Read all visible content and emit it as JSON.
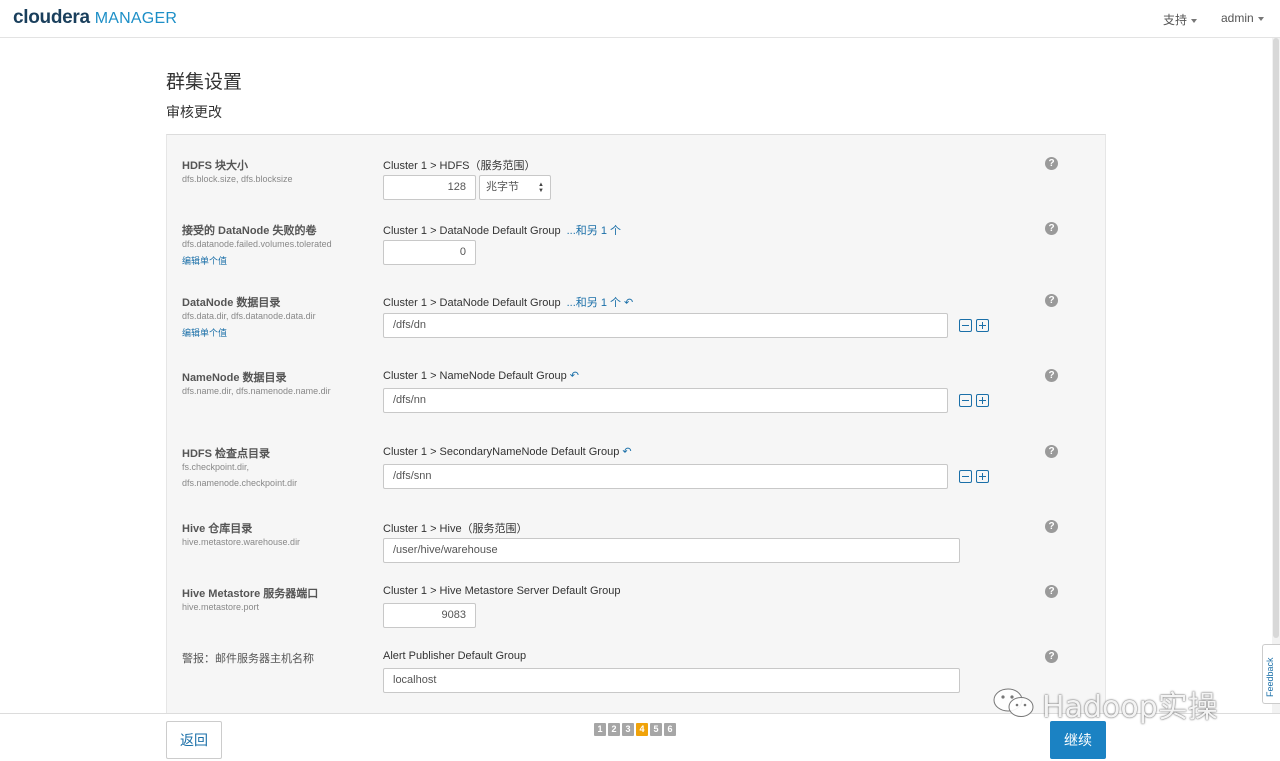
{
  "header": {
    "logo_brand": "cloudera",
    "logo_product": "MANAGER",
    "support_label": "支持",
    "user_label": "admin"
  },
  "page": {
    "title": "群集设置",
    "subtitle": "审核更改"
  },
  "settings": [
    {
      "label": "HDFS 块大小",
      "keys": [
        "dfs.block.size, dfs.blocksize"
      ],
      "scope": "Cluster 1 > HDFS（服务范围）",
      "value": "128",
      "unit": "兆字节"
    },
    {
      "label": "接受的 DataNode 失败的卷",
      "keys": [
        "dfs.datanode.failed.volumes.tolerated"
      ],
      "edit_link": "编辑单个值",
      "scope": "Cluster 1 > DataNode Default Group",
      "scope_more": "...和另 1 个",
      "value": "0"
    },
    {
      "label": "DataNode 数据目录",
      "keys": [
        "dfs.data.dir, dfs.datanode.data.dir"
      ],
      "edit_link": "编辑单个值",
      "scope": "Cluster 1 > DataNode Default Group",
      "scope_more": "...和另 1 个",
      "value": "/dfs/dn"
    },
    {
      "label": "NameNode 数据目录",
      "keys": [
        "dfs.name.dir, dfs.namenode.name.dir"
      ],
      "scope": "Cluster 1 > NameNode Default Group",
      "value": "/dfs/nn"
    },
    {
      "label": "HDFS 检查点目录",
      "keys": [
        "fs.checkpoint.dir,",
        "dfs.namenode.checkpoint.dir"
      ],
      "scope": "Cluster 1 > SecondaryNameNode Default Group",
      "value": "/dfs/snn"
    },
    {
      "label": "Hive 仓库目录",
      "keys": [
        "hive.metastore.warehouse.dir"
      ],
      "scope": "Cluster 1 > Hive（服务范围）",
      "value": "/user/hive/warehouse"
    },
    {
      "label": "Hive Metastore 服务器端口",
      "keys": [
        "hive.metastore.port"
      ],
      "scope": "Cluster 1 > Hive Metastore Server Default Group",
      "value": "9083"
    },
    {
      "label": "警报：邮件服务器主机名称",
      "scope": "Alert Publisher Default Group",
      "value": "localhost"
    }
  ],
  "icons": {
    "help": "?",
    "undo": "↶"
  },
  "footer": {
    "back_label": "返回",
    "next_label": "继续",
    "steps": [
      "1",
      "2",
      "3",
      "4",
      "5",
      "6"
    ],
    "active_step": "4"
  },
  "watermark": "Hadoop实操",
  "feedback_label": "Feedback"
}
